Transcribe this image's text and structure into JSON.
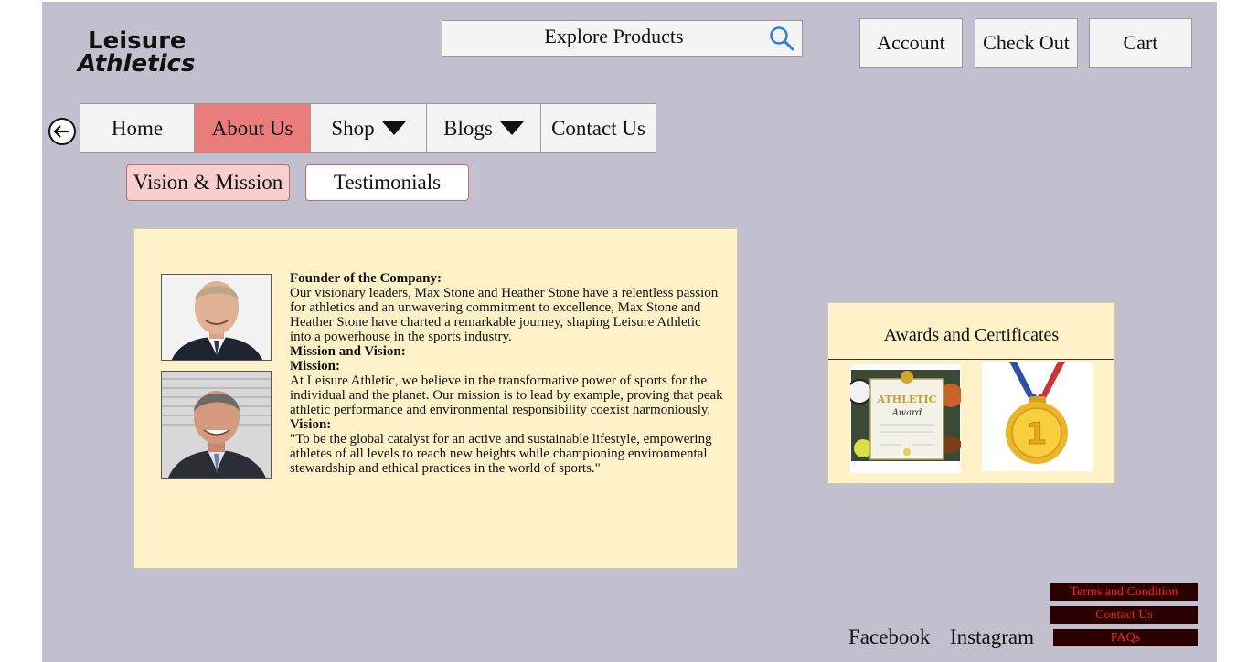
{
  "brand": {
    "line1": "Leisure",
    "line2": "Athletics"
  },
  "search": {
    "placeholder": "Explore Products"
  },
  "header_buttons": {
    "account": "Account",
    "checkout": "Check Out",
    "cart": "Cart"
  },
  "nav": {
    "home": "Home",
    "about": "About Us",
    "shop": "Shop",
    "blogs": "Blogs",
    "contact": "Contact Us",
    "active": "About Us"
  },
  "subtabs": {
    "vision": "Vision & Mission",
    "testimonials": "Testimonials"
  },
  "about": {
    "founder_heading": "Founder of the Company:",
    "founder_text": "Our visionary leaders, Max Stone and Heather Stone have a relentless passion for athletics and an unwavering commitment to excellence, Max Stone and Heather Stone have charted a remarkable journey, shaping Leisure Athletic into a powerhouse in the sports industry.",
    "mv_heading": "Mission and Vision:",
    "mission_heading": "Mission:",
    "mission_text": "At Leisure Athletic, we believe in the transformative power of sports for the individual and the planet. Our mission is to lead by example, proving that peak athletic performance and environmental responsibility coexist harmoniously.",
    "vision_heading": "Vision:",
    "vision_text": "\"To be the global catalyst for an active and sustainable lifestyle, empowering athletes of all levels to reach new heights while championing environmental stewardship and ethical practices in the world of sports.\""
  },
  "awards": {
    "title": "Awards and Certificates",
    "certificate_title": "ATHLETIC",
    "certificate_subtitle": "Award",
    "medal_number": "1"
  },
  "footer": {
    "facebook": "Facebook",
    "instagram": "Instagram",
    "terms": "Terms and Condition",
    "contact": "Contact Us",
    "faqs": "FAQs"
  },
  "colors": {
    "background": "#c2bfce",
    "panel": "#fff2c9",
    "active_tab": "#ea7c7c",
    "footer_button_bg": "#2a0000",
    "footer_button_text": "#ff2020"
  }
}
